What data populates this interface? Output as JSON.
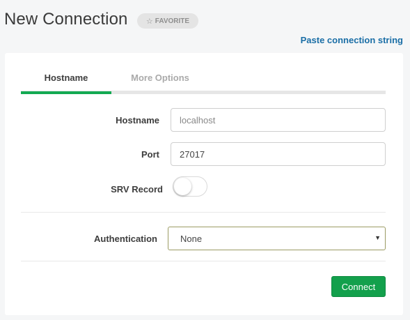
{
  "header": {
    "title": "New Connection",
    "favorite_label": "FAVORITE",
    "favorite_icon": "star-outline-icon",
    "paste_link": "Paste connection string"
  },
  "tabs": [
    {
      "label": "Hostname",
      "active": true
    },
    {
      "label": "More Options",
      "active": false
    }
  ],
  "form": {
    "hostname": {
      "label": "Hostname",
      "placeholder": "localhost",
      "value": ""
    },
    "port": {
      "label": "Port",
      "value": "27017"
    },
    "srv_record": {
      "label": "SRV Record",
      "enabled": false
    },
    "authentication": {
      "label": "Authentication",
      "selected": "None"
    }
  },
  "actions": {
    "connect_label": "Connect"
  },
  "colors": {
    "accent_green": "#13aa52",
    "link_blue": "#1a6ea6",
    "button_green": "#13a04c"
  }
}
